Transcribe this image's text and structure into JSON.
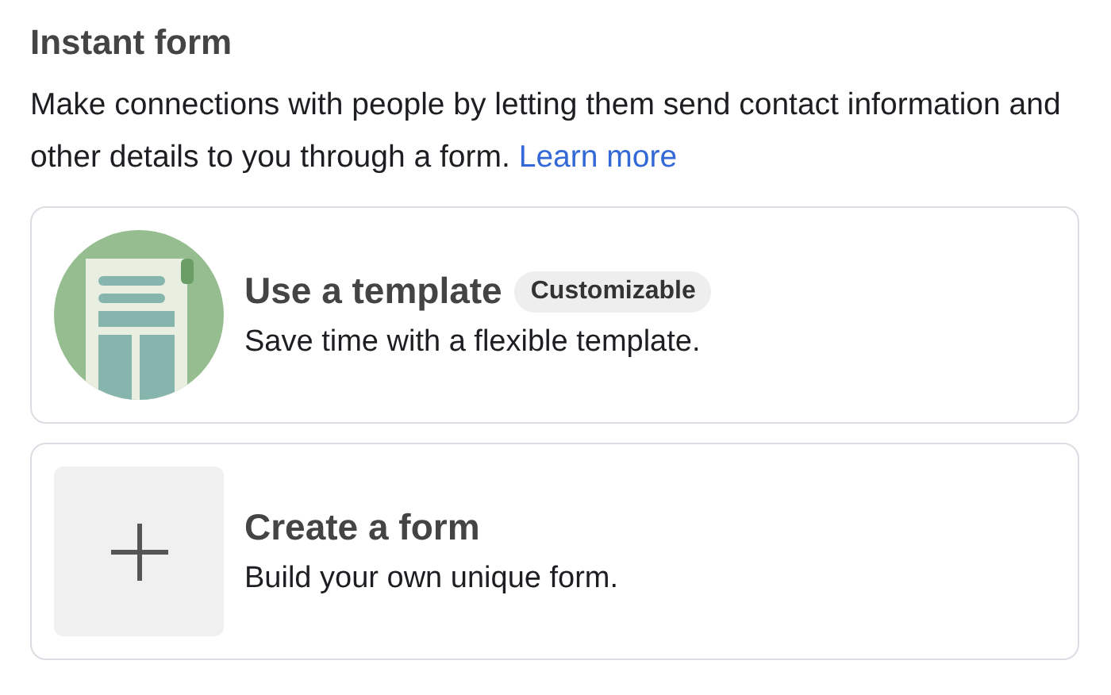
{
  "section": {
    "title": "Instant form",
    "description": "Make connections with people by letting them send contact information and other details to you through a form.",
    "link": "Learn more"
  },
  "options": [
    {
      "kind": "template",
      "title": "Use a template",
      "badge": "Customizable",
      "subtitle": "Save time with a flexible template."
    },
    {
      "kind": "blank",
      "title": "Create a form",
      "subtitle": "Build your own unique form."
    }
  ]
}
